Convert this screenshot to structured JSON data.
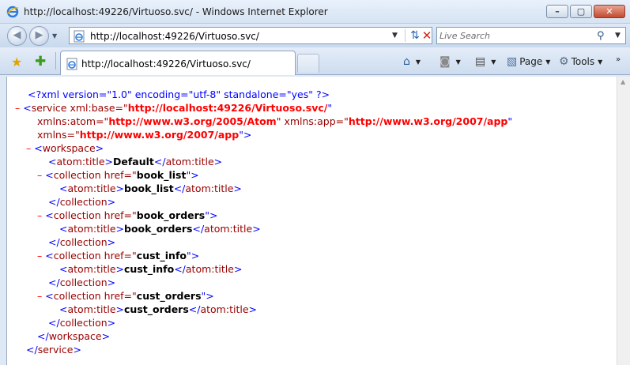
{
  "window": {
    "title": "http://localhost:49226/Virtuoso.svc/ - Windows Internet Explorer",
    "min_glyph": "–",
    "max_glyph": "▢",
    "close_glyph": "✕"
  },
  "nav": {
    "address": "http://localhost:49226/Virtuoso.svc/",
    "search_placeholder": "Live Search"
  },
  "tab": {
    "label": "http://localhost:49226/Virtuoso.svc/"
  },
  "commands": {
    "page": "Page",
    "tools": "Tools"
  },
  "xml": {
    "minus": "–",
    "l1": {
      "pi": "<?xml version=\"1.0\" encoding=\"utf-8\" standalone=\"yes\" ?>"
    },
    "l2": {
      "open": "<",
      "tag": "service",
      "attr": " xml:base=\"",
      "val": "http://localhost:49226/Virtuoso.svc/",
      "close": "\""
    },
    "l3": {
      "a1": "xmlns:atom=\"",
      "v1": "http://www.w3.org/2005/Atom",
      "a2": "\" xmlns:app=\"",
      "v2": "http://www.w3.org/2007/app",
      "end": "\""
    },
    "l4": {
      "a": "xmlns=\"",
      "v": "http://www.w3.org/2007/app",
      "end": "\">"
    },
    "l5": {
      "open": "<",
      "tag": "workspace",
      "end": ">"
    },
    "l6": {
      "o": "<",
      "t": "atom:title",
      "c": ">",
      "text": "Default",
      "eo": "</",
      "et": "atom:title",
      "ec": ">"
    },
    "collections": [
      {
        "href": "book_list",
        "title": "book_list"
      },
      {
        "href": "book_orders",
        "title": "book_orders"
      },
      {
        "href": "cust_info",
        "title": "cust_info"
      },
      {
        "href": "cust_orders",
        "title": "cust_orders"
      }
    ],
    "coll_open_a": "<",
    "coll_tag": "collection",
    "coll_attr": " href=\"",
    "coll_attr_end": "\">",
    "title_open": "<",
    "title_tag": "atom:title",
    "title_gt": ">",
    "title_close_open": "</",
    "coll_close_open": "</",
    "coll_close_end": ">",
    "ws_close_open": "</",
    "ws_tag": "workspace",
    "ws_close_end": ">",
    "svc_close_open": "</",
    "svc_tag": "service",
    "svc_close_end": ">"
  }
}
